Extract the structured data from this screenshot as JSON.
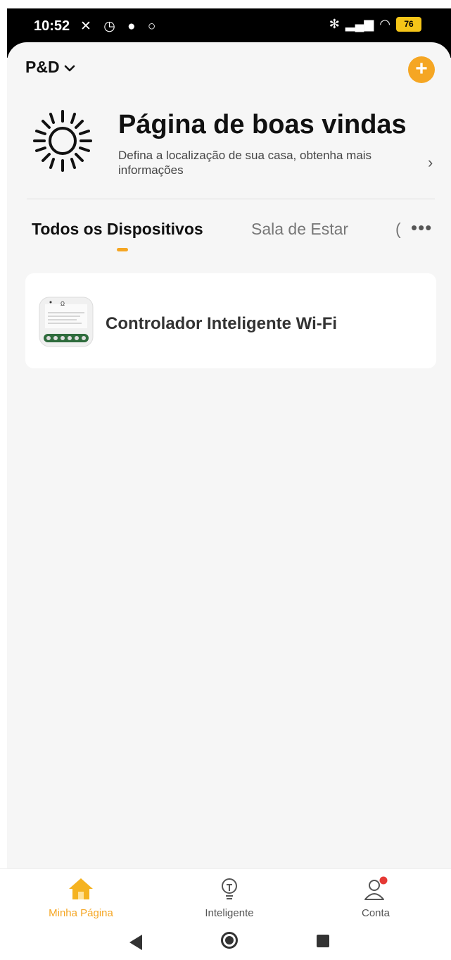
{
  "status_bar": {
    "time": "10:52",
    "left_icons": [
      "mute-icon",
      "alarm-icon",
      "spotify-icon",
      "circle-icon"
    ],
    "right_icons": [
      "bluetooth-icon",
      "signal-icon",
      "wifi-icon"
    ],
    "battery": "76"
  },
  "header": {
    "home_name": "P&D",
    "dropdown_glyph": "⌄"
  },
  "welcome": {
    "title": "Página de boas vindas",
    "subtitle": "Defina a localização de sua casa, obtenha mais informações",
    "chevron": "›"
  },
  "tabs": [
    {
      "label": "Todos os Dispositivos",
      "active": true
    },
    {
      "label": "Sala de Estar",
      "active": false
    },
    {
      "label": "(",
      "active": false
    }
  ],
  "tabs_more": "•••",
  "devices": [
    {
      "name": "Controlador Inteligente Wi-Fi"
    }
  ],
  "bottom_nav": [
    {
      "label": "Minha Página",
      "icon": "home-icon",
      "active": true
    },
    {
      "label": "Inteligente",
      "icon": "bulb-icon",
      "active": false
    },
    {
      "label": "Conta",
      "icon": "user-icon",
      "active": false,
      "badge": true
    }
  ],
  "colors": {
    "accent": "#f5a623",
    "badge": "#e53935",
    "background": "#f6f6f6"
  }
}
